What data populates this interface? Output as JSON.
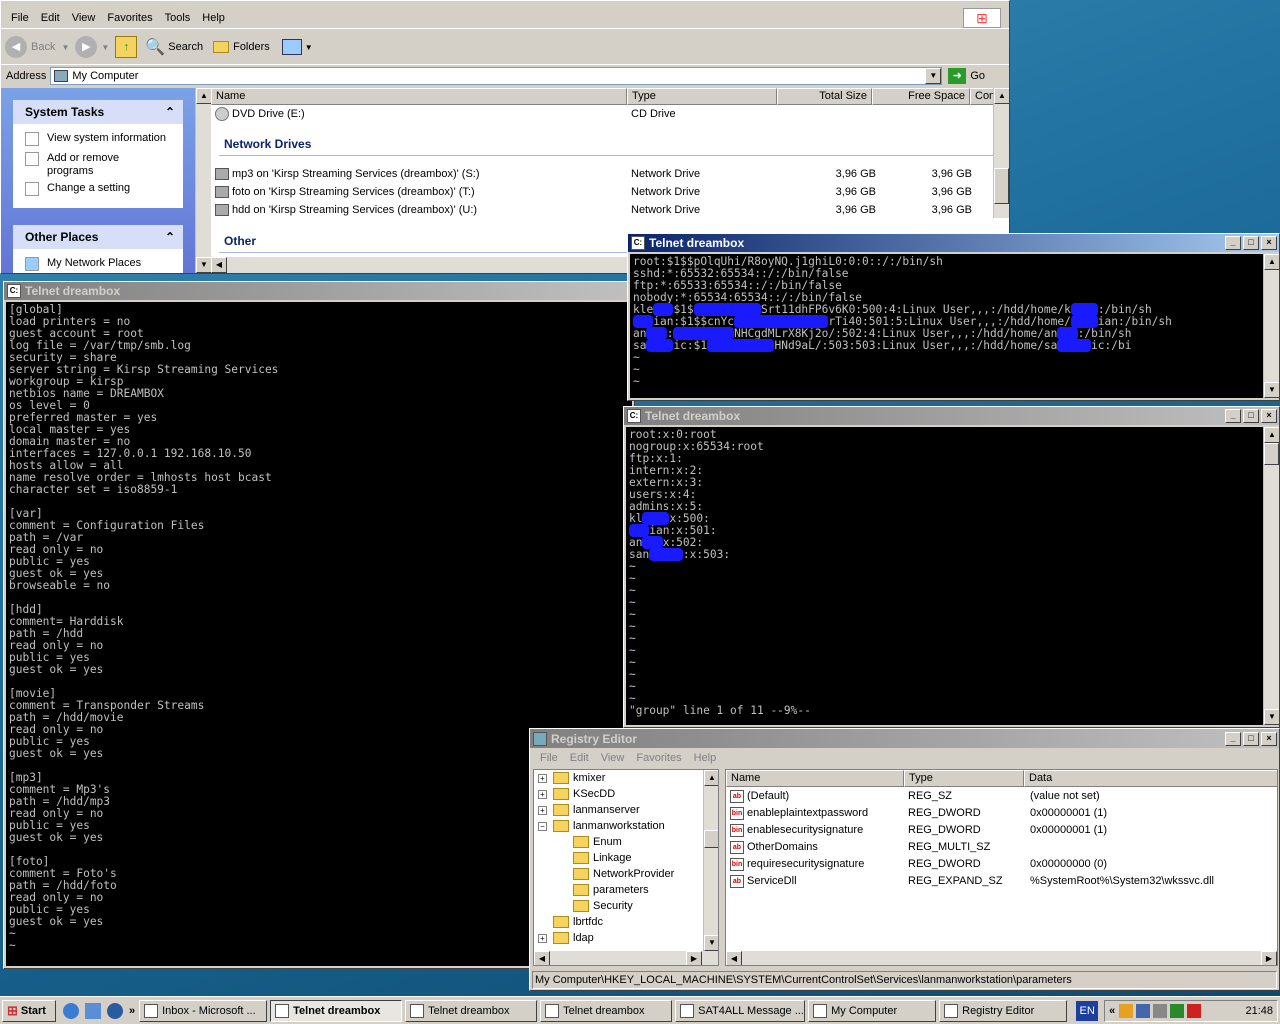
{
  "explorer": {
    "title": "My Computer",
    "menu": [
      "File",
      "Edit",
      "View",
      "Favorites",
      "Tools",
      "Help"
    ],
    "toolbar": {
      "back": "Back",
      "search": "Search",
      "folders": "Folders"
    },
    "address_label": "Address",
    "address_value": "My Computer",
    "go": "Go",
    "system_tasks": {
      "title": "System Tasks",
      "items": [
        "View system information",
        "Add or remove programs",
        "Change a setting"
      ]
    },
    "other_places": {
      "title": "Other Places",
      "items": [
        "My Network Places"
      ]
    },
    "columns": [
      "Name",
      "Type",
      "Total Size",
      "Free Space",
      "Com"
    ],
    "rows_top": [
      {
        "name": "DVD Drive (E:)",
        "type": "CD Drive",
        "total": "",
        "free": ""
      }
    ],
    "group_network": "Network Drives",
    "rows_network": [
      {
        "name": "mp3 on 'Kirsp Streaming Services (dreambox)' (S:)",
        "type": "Network Drive",
        "total": "3,96 GB",
        "free": "3,96 GB"
      },
      {
        "name": "foto on 'Kirsp Streaming Services (dreambox)' (T:)",
        "type": "Network Drive",
        "total": "3,96 GB",
        "free": "3,96 GB"
      },
      {
        "name": "hdd on 'Kirsp Streaming Services (dreambox)' (U:)",
        "type": "Network Drive",
        "total": "3,96 GB",
        "free": "3,96 GB"
      }
    ],
    "group_other": "Other"
  },
  "telnet_smb": {
    "title": "Telnet dreambox",
    "lines": [
      "[global]",
      "load printers = no",
      "guest account = root",
      "log file = /var/tmp/smb.log",
      "security = share",
      "server string = Kirsp Streaming Services",
      "workgroup = kirsp",
      "netbios name = DREAMBOX",
      "os level = 0",
      "preferred master = yes",
      "local master = yes",
      "domain master = no",
      "interfaces = 127.0.0.1 192.168.10.50",
      "hosts allow = all",
      "name resolve order = lmhosts host bcast",
      "character set = iso8859-1",
      "",
      "[var]",
      "comment = Configuration Files",
      "path = /var",
      "read only = no",
      "public = yes",
      "guest ok = yes",
      "browseable = no",
      "",
      "[hdd]",
      "comment= Harddisk",
      "path = /hdd",
      "read only = no",
      "public = yes",
      "guest ok = yes",
      "",
      "[movie]",
      "comment = Transponder Streams",
      "path = /hdd/movie",
      "read only = no",
      "public = yes",
      "guest ok = yes",
      "",
      "[mp3]",
      "comment = Mp3's",
      "path = /hdd/mp3",
      "read only = no",
      "public = yes",
      "guest ok = yes",
      "",
      "[foto]",
      "comment = Foto's",
      "path = /hdd/foto",
      "read only = no",
      "public = yes",
      "guest ok = yes",
      "~",
      "~"
    ]
  },
  "telnet_passwd": {
    "title": "Telnet dreambox",
    "lines": [
      [
        "root:$1$$pOlqUhi/R8oyNQ.j1ghiL0:0:0::/:/bin/sh"
      ],
      [
        "sshd:*:65532:65534::/:/bin/false"
      ],
      [
        "ftp:*:65533:65534::/:/bin/false"
      ],
      [
        "nobody:*:65534:65534::/:/bin/false"
      ],
      [
        "kle",
        "###",
        "$1$",
        "##########",
        "Srt11dhFP6v6K0:500:4:Linux User,,,:/hdd/home/k",
        "####",
        ":/bin/sh"
      ],
      [
        "",
        "###",
        "ian:$1$$cnYc",
        "##############",
        "rTi40:501:5:Linux User,,,:/hdd/home/",
        "####",
        "ian:/bin/sh"
      ],
      [
        "an",
        "###",
        ":",
        "#########",
        "NHCgdMLrX8Kj2o/:502:4:Linux User,,,:/hdd/home/an",
        "###",
        ":/bin/sh"
      ],
      [
        "sa",
        "####",
        "ic:$1",
        "##########",
        "HNd9aL/:503:503:Linux User,,,:/hdd/home/sa",
        "#####",
        "ic:/bi"
      ],
      [
        "~"
      ],
      [
        "~"
      ],
      [
        "~"
      ]
    ]
  },
  "telnet_group": {
    "title": "Telnet dreambox",
    "lines": [
      [
        "root:x:0:root"
      ],
      [
        "nogroup:x:65534:root"
      ],
      [
        "ftp:x:1:"
      ],
      [
        "intern:x:2:"
      ],
      [
        "extern:x:3:"
      ],
      [
        "users:x:4:"
      ],
      [
        "admins:x:5:"
      ],
      [
        "kl",
        "####",
        "x:500:"
      ],
      [
        "",
        "###",
        "ian:x:501:"
      ],
      [
        "an",
        "###",
        "x:502:"
      ],
      [
        "san",
        "#####",
        ":x:503:"
      ],
      [
        "~"
      ],
      [
        "~"
      ],
      [
        "~"
      ],
      [
        "~"
      ],
      [
        "~"
      ],
      [
        "~"
      ],
      [
        "~"
      ],
      [
        "~"
      ],
      [
        "~"
      ],
      [
        "~"
      ],
      [
        "~"
      ],
      [
        "~"
      ],
      [
        "\"group\" line 1 of 11 --9%--"
      ]
    ]
  },
  "regedit": {
    "title": "Registry Editor",
    "menu": [
      "File",
      "Edit",
      "View",
      "Favorites",
      "Help"
    ],
    "tree": [
      {
        "label": "kmixer",
        "indent": 0,
        "exp": "+"
      },
      {
        "label": "KSecDD",
        "indent": 0,
        "exp": "+"
      },
      {
        "label": "lanmanserver",
        "indent": 0,
        "exp": "+"
      },
      {
        "label": "lanmanworkstation",
        "indent": 0,
        "exp": "-"
      },
      {
        "label": "Enum",
        "indent": 1,
        "exp": ""
      },
      {
        "label": "Linkage",
        "indent": 1,
        "exp": ""
      },
      {
        "label": "NetworkProvider",
        "indent": 1,
        "exp": ""
      },
      {
        "label": "parameters",
        "indent": 1,
        "exp": ""
      },
      {
        "label": "Security",
        "indent": 1,
        "exp": ""
      },
      {
        "label": "lbrtfdc",
        "indent": 0,
        "exp": ""
      },
      {
        "label": "ldap",
        "indent": 0,
        "exp": "+"
      }
    ],
    "columns": [
      "Name",
      "Type",
      "Data"
    ],
    "values": [
      {
        "icon": "ab",
        "name": "(Default)",
        "type": "REG_SZ",
        "data": "(value not set)"
      },
      {
        "icon": "bin",
        "name": "enableplaintextpassword",
        "type": "REG_DWORD",
        "data": "0x00000001 (1)"
      },
      {
        "icon": "bin",
        "name": "enablesecuritysignature",
        "type": "REG_DWORD",
        "data": "0x00000001 (1)"
      },
      {
        "icon": "ab",
        "name": "OtherDomains",
        "type": "REG_MULTI_SZ",
        "data": ""
      },
      {
        "icon": "bin",
        "name": "requiresecuritysignature",
        "type": "REG_DWORD",
        "data": "0x00000000 (0)"
      },
      {
        "icon": "ab",
        "name": "ServiceDll",
        "type": "REG_EXPAND_SZ",
        "data": "%SystemRoot%\\System32\\wkssvc.dll"
      }
    ],
    "status": "My Computer\\HKEY_LOCAL_MACHINE\\SYSTEM\\CurrentControlSet\\Services\\lanmanworkstation\\parameters"
  },
  "taskbar": {
    "start": "Start",
    "tasks": [
      "Inbox - Microsoft ...",
      "Telnet dreambox",
      "Telnet dreambox",
      "Telnet dreambox",
      "SAT4ALL Message ...",
      "My Computer",
      "Registry Editor"
    ],
    "active_index": 1,
    "lang": "EN",
    "clock": "21:48"
  },
  "colors": {
    "titlebar_active": "#0a246a",
    "redaction": "#1a1aff",
    "console_bg": "#000000",
    "console_fg": "#c0c0c0"
  }
}
